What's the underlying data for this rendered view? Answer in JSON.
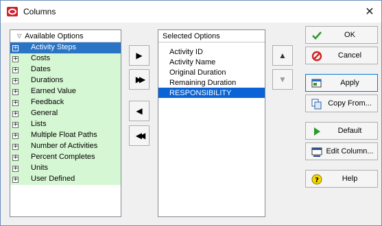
{
  "window": {
    "title": "Columns",
    "close_glyph": "✕"
  },
  "available": {
    "header": "Available Options",
    "items": [
      {
        "label": "Activity Steps",
        "selected": true
      },
      {
        "label": "Costs"
      },
      {
        "label": "Dates"
      },
      {
        "label": "Durations"
      },
      {
        "label": "Earned Value"
      },
      {
        "label": "Feedback"
      },
      {
        "label": "General"
      },
      {
        "label": "Lists"
      },
      {
        "label": "Multiple Float Paths"
      },
      {
        "label": "Number of Activities"
      },
      {
        "label": "Percent Completes"
      },
      {
        "label": "Units"
      },
      {
        "label": "User Defined"
      }
    ]
  },
  "transfer": {
    "add": "▶",
    "add_all": "▶▶",
    "remove": "◀",
    "remove_all": "◀◀"
  },
  "selected": {
    "header": "Selected Options",
    "items": [
      {
        "label": "Activity ID"
      },
      {
        "label": "Activity Name"
      },
      {
        "label": "Original Duration"
      },
      {
        "label": "Remaining Duration"
      },
      {
        "label": "RESPONSIBILITY",
        "selected": true
      }
    ]
  },
  "order": {
    "up": "▲",
    "down": "▼"
  },
  "actions": {
    "ok": "OK",
    "cancel": "Cancel",
    "apply": "Apply",
    "copy_from": "Copy From...",
    "default": "Default",
    "edit_column": "Edit Column...",
    "help": "Help"
  },
  "colors": {
    "tree_bg": "#d6f7d3",
    "selection": "#0a64d6",
    "ok_green": "#2a9a2a",
    "cancel_red": "#d42020",
    "help_yellow": "#f5d800",
    "app_icon_red": "#d0202a"
  }
}
